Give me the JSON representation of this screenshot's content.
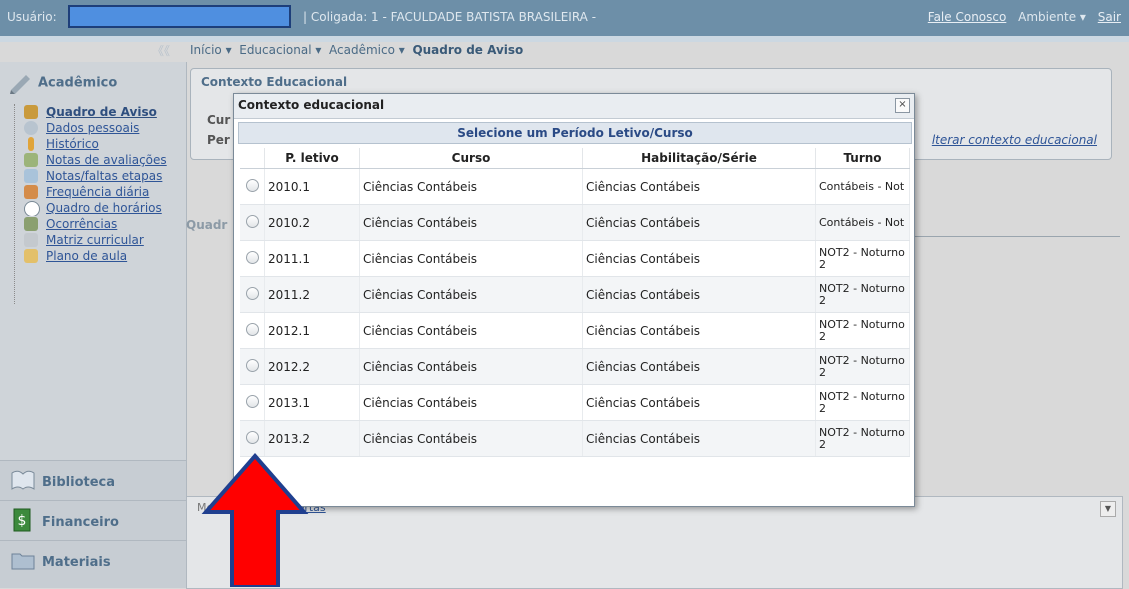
{
  "topbar": {
    "user_label": "Usuário:",
    "coligada": "| Coligada: 1 - FACULDADE BATISTA BRASILEIRA -",
    "fale_conosco": "Fale Conosco",
    "ambiente": "Ambiente ▾",
    "sair": "Sair"
  },
  "breadcrumb": {
    "inicio": "Início ▾",
    "educacional": "Educacional ▾",
    "academico": "Acadêmico ▾",
    "current": "Quadro de Aviso",
    "collapse": "《《"
  },
  "sidebar": {
    "section_title": "Acadêmico",
    "items": [
      {
        "label": "Quadro de Aviso",
        "icon": "users-icon"
      },
      {
        "label": "Dados pessoais",
        "icon": "person-icon"
      },
      {
        "label": "Histórico",
        "icon": "pencil-icon"
      },
      {
        "label": "Notas de avaliações",
        "icon": "pen-icon"
      },
      {
        "label": "Notas/faltas etapas",
        "icon": "table-icon"
      },
      {
        "label": "Frequência diária",
        "icon": "chart-icon"
      },
      {
        "label": "Quadro de horários",
        "icon": "clock-icon"
      },
      {
        "label": "Ocorrências",
        "icon": "note-icon"
      },
      {
        "label": "Matriz curricular",
        "icon": "check-icon"
      },
      {
        "label": "Plano de aula",
        "icon": "book-icon"
      }
    ],
    "bottom": [
      {
        "label": "Biblioteca",
        "icon": "books-icon"
      },
      {
        "label": "Financeiro",
        "icon": "money-icon"
      },
      {
        "label": "Materiais",
        "icon": "folder-icon"
      }
    ]
  },
  "context_box": {
    "title": "Contexto Educacional",
    "cur_label": "Cur",
    "per_label": "Per",
    "alterar": "lterar contexto educacional"
  },
  "quadro_label": "Quadr",
  "messages": {
    "tab1": "Mens",
    "tab2": "Alertas"
  },
  "modal": {
    "title": "Contexto educacional",
    "close": "×",
    "subtitle": "Selecione um Período Letivo/Curso",
    "headers": [
      "P. letivo",
      "Curso",
      "Habilitação/Série",
      "Turno"
    ],
    "rows": [
      {
        "periodo": "2010.1",
        "curso": "Ciências Contábeis",
        "habilitacao": "Ciências Contábeis",
        "turno": "Contábeis - Not"
      },
      {
        "periodo": "2010.2",
        "curso": "Ciências Contábeis",
        "habilitacao": "Ciências Contábeis",
        "turno": "Contábeis - Not"
      },
      {
        "periodo": "2011.1",
        "curso": "Ciências Contábeis",
        "habilitacao": "Ciências Contábeis",
        "turno": "NOT2 - Noturno 2"
      },
      {
        "periodo": "2011.2",
        "curso": "Ciências Contábeis",
        "habilitacao": "Ciências Contábeis",
        "turno": "NOT2 - Noturno 2"
      },
      {
        "periodo": "2012.1",
        "curso": "Ciências Contábeis",
        "habilitacao": "Ciências Contábeis",
        "turno": "NOT2 - Noturno 2"
      },
      {
        "periodo": "2012.2",
        "curso": "Ciências Contábeis",
        "habilitacao": "Ciências Contábeis",
        "turno": "NOT2 - Noturno 2"
      },
      {
        "periodo": "2013.1",
        "curso": "Ciências Contábeis",
        "habilitacao": "Ciências Contábeis",
        "turno": "NOT2 - Noturno 2"
      },
      {
        "periodo": "2013.2",
        "curso": "Ciências Contábeis",
        "habilitacao": "Ciências Contábeis",
        "turno": "NOT2 - Noturno 2"
      }
    ]
  },
  "colors": {
    "topbar": "#6d8fa8",
    "link": "#2f5597",
    "arrow_fill": "#ff0000",
    "arrow_stroke": "#1f3f8f",
    "user_field": "#4f8fe0"
  }
}
